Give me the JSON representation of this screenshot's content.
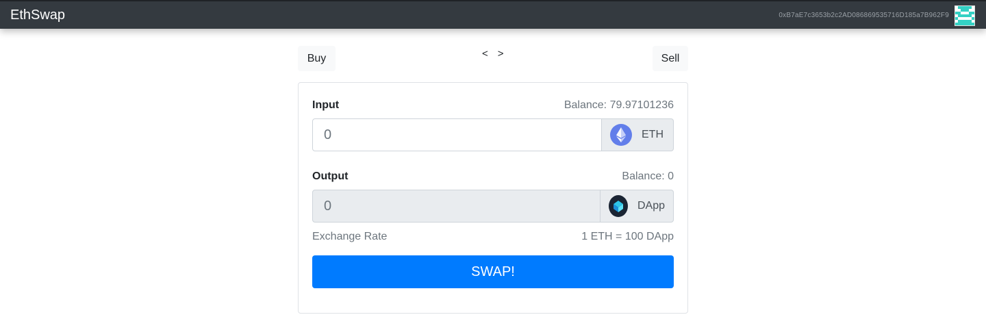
{
  "navbar": {
    "brand": "EthSwap",
    "account": "0xB7aE7c3653b2c2AD086869535716D185a7B962F9"
  },
  "toggle": {
    "buy_label": "Buy",
    "sell_label": "Sell",
    "prev_arrow": "<",
    "next_arrow": ">"
  },
  "form": {
    "input_label": "Input",
    "input_balance": "Balance: 79.97101236",
    "input_placeholder": "0",
    "input_token": "ETH",
    "output_label": "Output",
    "output_balance": "Balance: 0",
    "output_placeholder": "0",
    "output_token": "DApp",
    "rate_label": "Exchange Rate",
    "rate_value": "1 ETH = 100 DApp",
    "swap_label": "SWAP!"
  },
  "colors": {
    "navbar": "#343a40",
    "primary": "#007bff",
    "eth": "#627eea",
    "dapp": "#1a2433"
  },
  "icons": {
    "avatar": "identicon-avatar",
    "input_token_icon": "ethereum-icon",
    "output_token_icon": "dapp-token-icon"
  }
}
